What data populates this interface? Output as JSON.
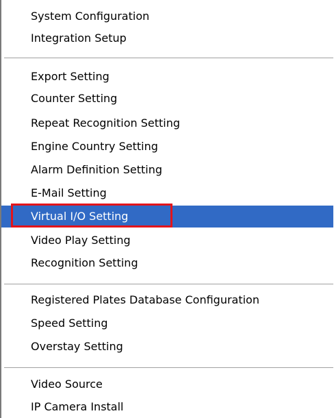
{
  "menu": {
    "group1": [
      {
        "label": "System Configuration"
      },
      {
        "label": "Integration Setup"
      }
    ],
    "group2": [
      {
        "label": "Export Setting"
      },
      {
        "label": "Counter Setting"
      },
      {
        "label": "Repeat Recognition Setting"
      },
      {
        "label": "Engine Country Setting"
      },
      {
        "label": "Alarm Definition Setting"
      },
      {
        "label": "E-Mail Setting"
      },
      {
        "label": "Virtual I/O Setting",
        "selected": true
      },
      {
        "label": "Video Play Setting"
      },
      {
        "label": "Recognition Setting"
      }
    ],
    "group3": [
      {
        "label": "Registered Plates Database Configuration"
      },
      {
        "label": "Speed Setting"
      },
      {
        "label": "Overstay Setting"
      }
    ],
    "group4": [
      {
        "label": "Video Source"
      },
      {
        "label": "IP Camera Install"
      }
    ]
  },
  "colors": {
    "selection_bg": "#316ac5",
    "annotation_box": "#e3141b"
  }
}
